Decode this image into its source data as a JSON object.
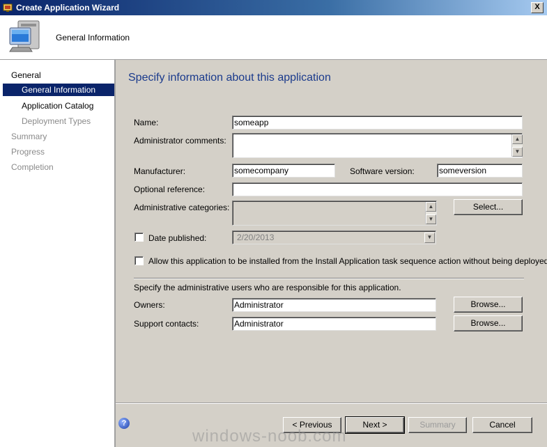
{
  "window": {
    "title": "Create Application Wizard",
    "close_label": "X"
  },
  "header": {
    "title": "General Information"
  },
  "sidebar": {
    "items": [
      {
        "label": "General"
      },
      {
        "label": "General Information"
      },
      {
        "label": "Application Catalog"
      },
      {
        "label": "Deployment Types"
      },
      {
        "label": "Summary"
      },
      {
        "label": "Progress"
      },
      {
        "label": "Completion"
      }
    ]
  },
  "main": {
    "heading": "Specify information about this application",
    "name": {
      "label": "Name:",
      "value": "someapp"
    },
    "admin_comments": {
      "label": "Administrator comments:",
      "value": ""
    },
    "manufacturer": {
      "label": "Manufacturer:",
      "value": "somecompany"
    },
    "software_version": {
      "label": "Software version:",
      "value": "someversion"
    },
    "optional_reference": {
      "label": "Optional reference:",
      "value": ""
    },
    "admin_categories": {
      "label": "Administrative categories:",
      "select_label": "Select..."
    },
    "date_published": {
      "label": "Date published:",
      "value": "2/20/2013",
      "checked": false
    },
    "allow_install": {
      "label": "Allow this application to be installed from the Install Application task sequence action without being deployed",
      "checked": false
    },
    "admin_users_text": "Specify the administrative users who are responsible for this application.",
    "owners": {
      "label": "Owners:",
      "value": "Administrator",
      "browse_label": "Browse..."
    },
    "support_contacts": {
      "label": "Support contacts:",
      "value": "Administrator",
      "browse_label": "Browse..."
    }
  },
  "footer": {
    "help_label": "?",
    "previous_label": "< Previous",
    "next_label": "Next >",
    "summary_label": "Summary",
    "cancel_label": "Cancel"
  },
  "watermark": "windows-noob.com"
}
